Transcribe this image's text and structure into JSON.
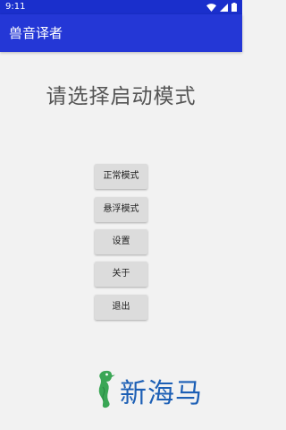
{
  "status_bar": {
    "time": "9:11",
    "icons": [
      "wifi-icon",
      "signal-icon",
      "battery-icon"
    ]
  },
  "app_bar": {
    "title": "兽音译者"
  },
  "main": {
    "prompt": "请选择启动模式",
    "buttons": [
      {
        "label": "正常模式"
      },
      {
        "label": "悬浮模式"
      },
      {
        "label": "设置"
      },
      {
        "label": "关于"
      },
      {
        "label": "退出"
      }
    ]
  },
  "watermark": {
    "text": "新海马"
  },
  "colors": {
    "status_bar": "#1a2fcc",
    "app_bar": "#2437d6",
    "background": "#f2f2f2",
    "button": "#dcdcdc",
    "watermark_blue": "#1c5fb5",
    "watermark_green": "#3aa655"
  }
}
